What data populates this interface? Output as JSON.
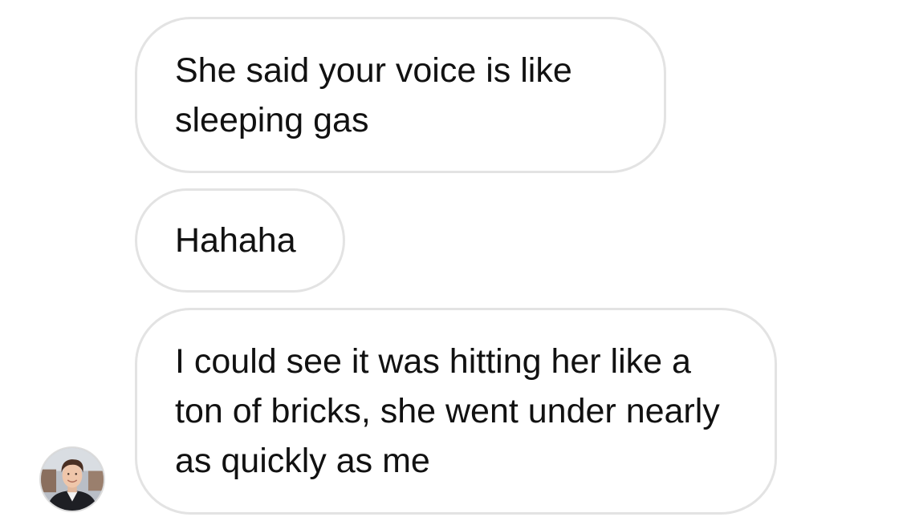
{
  "conversation": {
    "messages": [
      {
        "text": "She said your voice is like sleeping gas"
      },
      {
        "text": "Hahaha"
      },
      {
        "text": "I could see it was hitting her like a ton of bricks, she went under nearly as quickly as me"
      }
    ],
    "sender_avatar": {
      "icon": "profile-photo"
    }
  },
  "colors": {
    "bubble_border": "#e3e3e3",
    "bubble_background": "#ffffff",
    "text": "#111111",
    "page_background": "#ffffff"
  }
}
